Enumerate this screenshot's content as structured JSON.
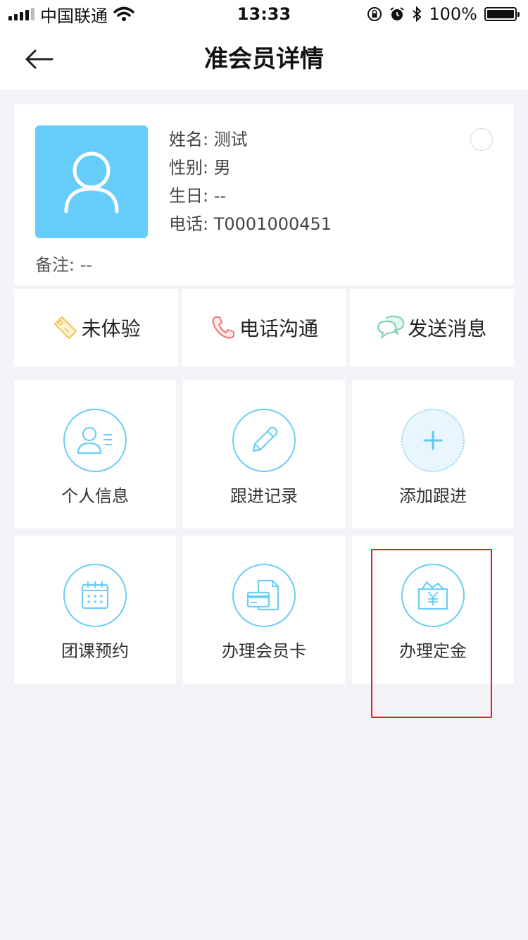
{
  "status_bar": {
    "carrier": "中国联通",
    "time": "13:33",
    "battery": "100%"
  },
  "nav": {
    "title": "准会员详情",
    "back_icon": "arrow-left-icon"
  },
  "profile": {
    "avatar_icon": "user-avatar-icon",
    "name_line": "姓名: 测试",
    "gender_line": "性别: 男",
    "birthday_line": "生日: --",
    "phone_line": "电话: T0001000451",
    "remark_line": "备注: --"
  },
  "actions": [
    {
      "label": "未体验",
      "icon": "tag-icon"
    },
    {
      "label": "电话沟通",
      "icon": "phone-icon"
    },
    {
      "label": "发送消息",
      "icon": "chat-icon"
    }
  ],
  "tiles": [
    {
      "label": "个人信息",
      "icon": "profile-card-icon"
    },
    {
      "label": "跟进记录",
      "icon": "pencil-icon"
    },
    {
      "label": "添加跟进",
      "icon": "plus-icon"
    },
    {
      "label": "团课预约",
      "icon": "calendar-icon"
    },
    {
      "label": "办理会员卡",
      "icon": "member-card-icon"
    },
    {
      "label": "办理定金",
      "icon": "deposit-yen-icon"
    }
  ],
  "colors": {
    "accent": "#6ccdf6",
    "avatar_bg": "#66cdfb",
    "highlight": "#e02020",
    "page_bg": "#f4f3f8"
  }
}
